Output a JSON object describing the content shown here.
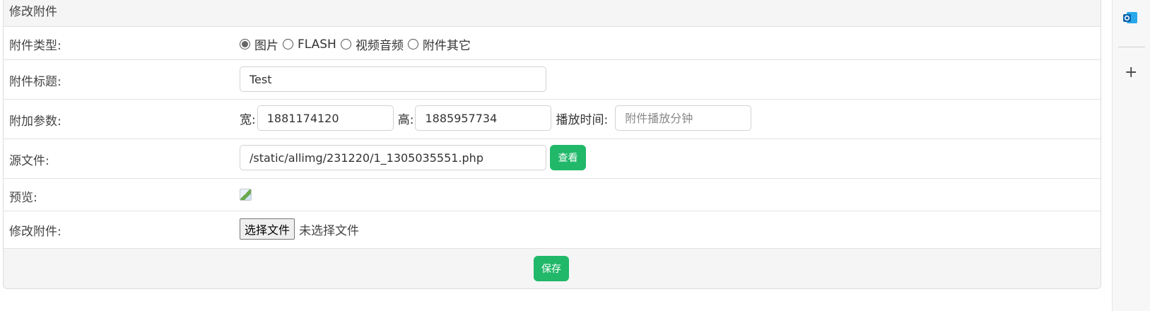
{
  "panel": {
    "title": "修改附件"
  },
  "rows": {
    "type": {
      "label": "附件类型:",
      "options": [
        "图片",
        "FLASH",
        "视频音频",
        "附件其它"
      ],
      "selected": "图片"
    },
    "title": {
      "label": "附件标题:",
      "value": "Test"
    },
    "params": {
      "label": "附加参数:",
      "width_label": "宽:",
      "width_value": "1881174120",
      "height_label": "高:",
      "height_value": "1885957734",
      "time_label": "播放时间:",
      "time_placeholder": "附件播放分钟"
    },
    "source": {
      "label": "源文件:",
      "value": "/static/allimg/231220/1_1305035551.php",
      "view_button": "查看"
    },
    "preview": {
      "label": "预览:"
    },
    "modify": {
      "label": "修改附件:",
      "choose_button": "选择文件",
      "status": "未选择文件"
    }
  },
  "footer": {
    "save_button": "保存"
  },
  "colors": {
    "accent": "#21b86a",
    "header_bg": "#f5f5f5"
  },
  "sidebar": {
    "icons": [
      "outlook-icon",
      "plus-icon"
    ]
  }
}
